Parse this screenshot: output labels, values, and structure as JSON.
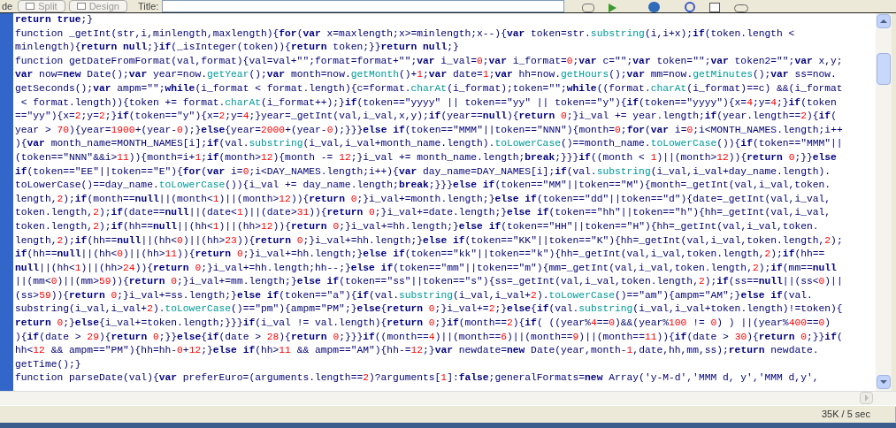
{
  "toolbar": {
    "tab_fragment": "de",
    "buttons": [
      {
        "label": "Split"
      },
      {
        "label": "Design"
      }
    ],
    "title_label": "Title:"
  },
  "code_lines": [
    "**return** **true**;}",
    "function _getInt(str,i,minlength,maxlength){**for**(**var** x=maxlength;x>=minlength;x--){**var** token=str.substring(i,i+x);**if**(token.length <",
    "minlength){**return** **null**;}**if**(_isInteger(token)){**return** token;}}**return** **null**;}",
    "function getDateFromFormat(val,format){val=val+\"\";format=format+\"\";**var** i_val=0;**var** i_format=0;**var** c=\"\";**var** token=\"\";**var** token2=\"\";**var** x,y;",
    "**var** now=**new** Date();**var** year=now.getYear();**var** month=now.getMonth()+1;**var** date=1;**var** hh=now.getHours();**var** mm=now.getMinutes();**var** ss=now.",
    "getSeconds();**var** ampm=\"\";**while**(i_format < format.length){c=format.charAt(i_format);token=\"\";**while**((format.charAt(i_format)==c) &&(i_format",
    " < format.length)){token += format.charAt(i_format++);}**if**(token==\"yyyy\" || token==\"yy\" || token==\"y\"){**if**(token==\"yyyy\"){x=4;y=4;}**if**(token",
    "==\"yy\"){x=2;y=2;}**if**(token==\"y\"){x=2;y=4;}year=_getInt(val,i_val,x,y);**if**(year==**null**){**return** 0;}i_val += year.length;**if**(year.length==2){**if**(",
    "year > 70){year=1900+(year-0);}**else**{year=2000+(year-0);}}}**else** **if**(token==\"MMM\"||token==\"NNN\"){month=0;**for**(**var** i=0;i<MONTH_NAMES.length;i++",
    "){**var** month_name=MONTH_NAMES[i];**if**(val.substring(i_val,i_val+month_name.length).toLowerCase()==month_name.toLowerCase()){**if**(token==\"MMM\"||",
    "(token==\"NNN\"&&i>11)){month=i+1;**if**(month>12){month -= 12;}i_val += month_name.length;**break**;}}}**if**((month < 1)||(month>12)){**return** 0;}}**else**",
    "**if**(token==\"EE\"||token==\"E\"){**for**(**var** i=0;i<DAY_NAMES.length;i++){**var** day_name=DAY_NAMES[i];**if**(val.substring(i_val,i_val+day_name.length).",
    "toLowerCase()==day_name.toLowerCase()){i_val += day_name.length;**break**;}}}**else** **if**(token==\"MM\"||token==\"M\"){month=_getInt(val,i_val,token.",
    "length,2);**if**(month==**null**||(month<1)||(month>12)){**return** 0;}i_val+=month.length;}**else** **if**(token==\"dd\"||token==\"d\"){date=_getInt(val,i_val,",
    "token.length,2);**if**(date==**null**||(date<1)||(date>31)){**return** 0;}i_val+=date.length;}**else** **if**(token==\"hh\"||token==\"h\"){hh=_getInt(val,i_val,",
    "token.length,2);**if**(hh==**null**||(hh<1)||(hh>12)){**return** 0;}i_val+=hh.length;}**else** **if**(token==\"HH\"||token==\"H\"){hh=_getInt(val,i_val,token.",
    "length,2);**if**(hh==**null**||(hh<0)||(hh>23)){**return** 0;}i_val+=hh.length;}**else** **if**(token==\"KK\"||token==\"K\"){hh=_getInt(val,i_val,token.length,2);",
    "**if**(hh==**null**||(hh<0)||(hh>11)){**return** 0;}i_val+=hh.length;}**else** **if**(token==\"kk\"||token==\"k\"){hh=_getInt(val,i_val,token.length,2);**if**(hh==",
    "**null**||(hh<1)||(hh>24)){**return** 0;}i_val+=hh.length;hh--;}**else** **if**(token==\"mm\"||token==\"m\"){mm=_getInt(val,i_val,token.length,2);**if**(mm==**null**",
    "||(mm<0)||(mm>59)){**return** 0;}i_val+=mm.length;}**else** **if**(token==\"ss\"||token==\"s\"){ss=_getInt(val,i_val,token.length,2);**if**(ss==**null**||(ss<0)||",
    "(ss>59)){**return** 0;}i_val+=ss.length;}**else** **if**(token==\"a\"){**if**(val.substring(i_val,i_val+2).toLowerCase()==\"am\"){ampm=\"AM\";}**else** **if**(val.",
    "substring(i_val,i_val+2).toLowerCase()==\"pm\"){ampm=\"PM\";}**else**{**return** 0;}i_val+=2;}**else**{**if**(val.substring(i_val,i_val+token.length)!=token){",
    "**return** 0;}**else**{i_val+=token.length;}}}**if**(i_val != val.length){**return** 0;}**if**(month==2){**if**( ((year%4==0)&&(year%100 != 0) ) ||(year%400==0)",
    "){**if**(date > 29){**return** 0;}}**else**{**if**(date > 28){**return** 0;}}}**if**((month==4)||(month==6)||(month==9)||(month==11)){**if**(date > 30){**return** 0;}}**if**(",
    "hh<12 && ampm==\"PM\"){hh=hh-0+12;}**else** **if**(hh>11 && ampm==\"AM\"){hh-=12;}**var** newdate=**new** Date(year,month-1,date,hh,mm,ss);**return** newdate.",
    "getTime();}",
    "function parseDate(val){**var** preferEuro=(arguments.length==2)?arguments[1]:**false**;generalFormats=**new** Array('y-M-d','MMM d, y','MMM d,y',"
  ],
  "status_bar": {
    "text": "35K / 5 sec"
  }
}
